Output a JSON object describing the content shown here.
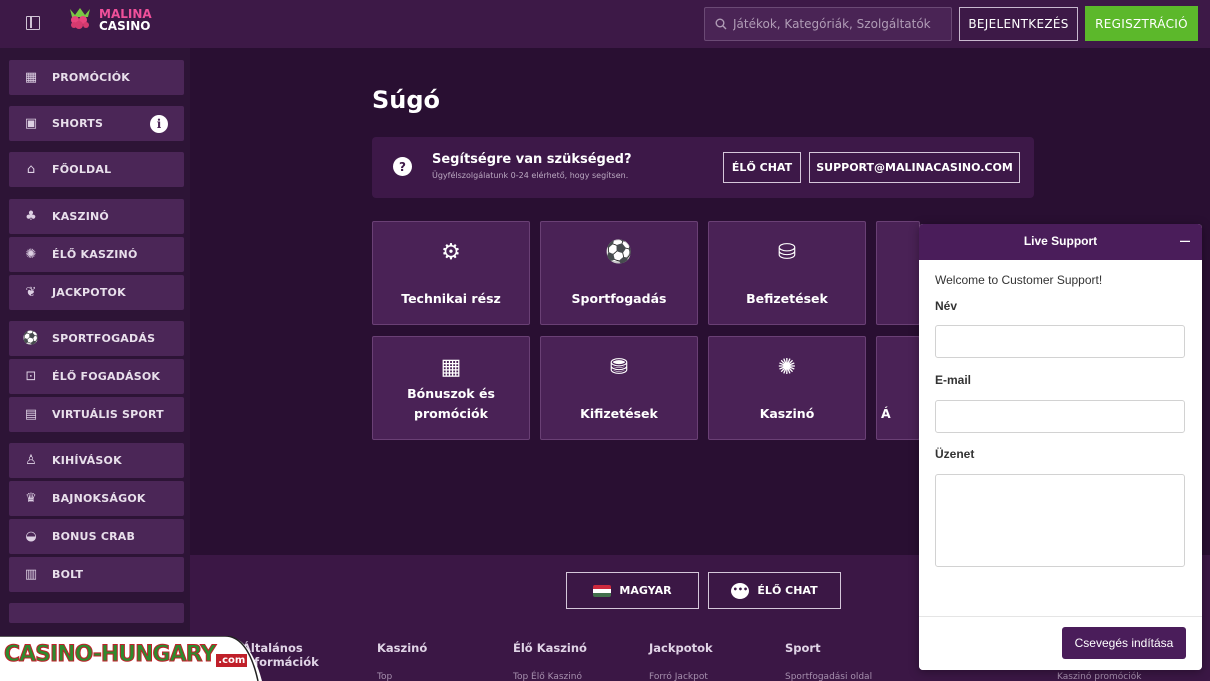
{
  "header": {
    "logo_line1": "MALINA",
    "logo_line2": "CASINO",
    "search_placeholder": "Játékok, Kategóriák, Szolgáltatók",
    "login_label": "BEJELENTKEZÉS",
    "register_label": "REGISZTRÁCIÓ"
  },
  "sidebar": {
    "items": [
      {
        "label": "PROMÓCIÓK",
        "icon": "gift-icon"
      },
      {
        "label": "SHORTS",
        "icon": "film-icon",
        "badge": "i"
      },
      {
        "label": "FŐOLDAL",
        "icon": "home-icon"
      },
      {
        "label": "KASZINÓ",
        "icon": "cherries-icon"
      },
      {
        "label": "ÉLŐ KASZINÓ",
        "icon": "chip-icon"
      },
      {
        "label": "JACKPOTOK",
        "icon": "raspberry-icon"
      },
      {
        "label": "SPORTFOGADÁS",
        "icon": "soccer-ball-icon"
      },
      {
        "label": "ÉLŐ FOGADÁSOK",
        "icon": "live-bet-icon"
      },
      {
        "label": "VIRTUÁLIS SPORT",
        "icon": "virtual-sport-icon"
      },
      {
        "label": "KIHÍVÁSOK",
        "icon": "challenge-icon"
      },
      {
        "label": "BAJNOKSÁGOK",
        "icon": "trophy-icon"
      },
      {
        "label": "BONUS CRAB",
        "icon": "crab-icon"
      },
      {
        "label": "BOLT",
        "icon": "shop-icon"
      }
    ]
  },
  "main": {
    "title": "Súgó",
    "help": {
      "title": "Segítségre van szükséged?",
      "subtitle": "Ügyfélszolgálatunk 0-24 elérhető, hogy segítsen.",
      "chat_label": "ÉLŐ CHAT",
      "email_label": "SUPPORT@MALINACASINO.COM"
    },
    "categories": [
      {
        "label": "Technikai rész",
        "icon": "gear-icon"
      },
      {
        "label": "Sportfogadás",
        "icon": "soccer-ball-icon"
      },
      {
        "label": "Befizetések",
        "icon": "coins-plus-icon"
      },
      {
        "label": "Bónuszok és promóciók",
        "icon": "gift-icon"
      },
      {
        "label": "Kifizetések",
        "icon": "coins-out-icon"
      },
      {
        "label": "Kaszinó",
        "icon": "chip-icon"
      },
      {
        "label": "Á",
        "icon": "partial-icon"
      }
    ]
  },
  "footer": {
    "language_label": "MAGYAR",
    "chat_label": "ÉLŐ CHAT",
    "columns": [
      "Általános információk",
      "Kaszinó",
      "Élő Kaszinó",
      "Jackpotok",
      "Sport"
    ],
    "sublinks": [
      "Top",
      "Top Élő Kaszinó",
      "Forró Jackpot",
      "Sportfogadási oldal",
      "Kaszinó promóciók"
    ]
  },
  "watermark": {
    "text": "CASINO-HUNGARY",
    "suffix": ".com"
  },
  "live_support": {
    "title": "Live Support",
    "minimize": "–",
    "welcome": "Welcome to Customer Support!",
    "name_label": "Név",
    "email_label": "E-mail",
    "message_label": "Üzenet",
    "start_label": "Csevegés indítása"
  },
  "colors": {
    "accent_green": "#5cb82b",
    "brand_purple": "#4a1d5a",
    "logo_pink": "#f0509a"
  }
}
